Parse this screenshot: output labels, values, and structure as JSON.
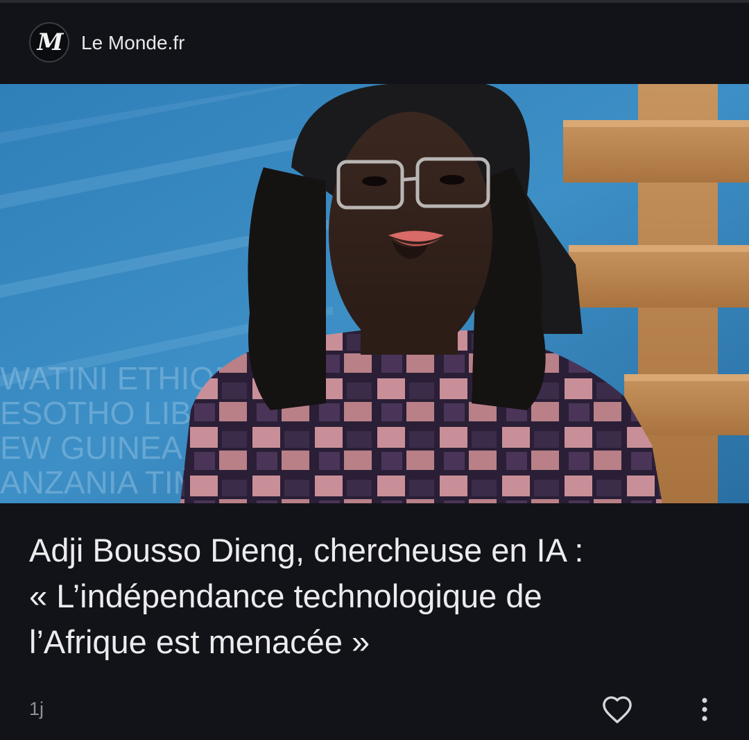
{
  "source": {
    "logo_letter": "M",
    "name": "Le Monde.fr"
  },
  "hero_image": {
    "description_icon": "portrait-photo",
    "background_words": [
      "WATINI ETHIOP",
      "ESOTHO LIBE",
      "EW GUINEA P",
      "ANZANIA TIM"
    ]
  },
  "article": {
    "headline_lines": [
      "Adji Bousso Dieng, chercheuse en IA :",
      "« L’indépendance technologique de",
      "l’Afrique est menacée »"
    ]
  },
  "footer": {
    "age": "1j",
    "like_icon": "heart-outline-icon",
    "more_icon": "more-vert-icon"
  },
  "colors": {
    "background": "#121318",
    "text": "#ececee",
    "muted": "#8f9096"
  }
}
